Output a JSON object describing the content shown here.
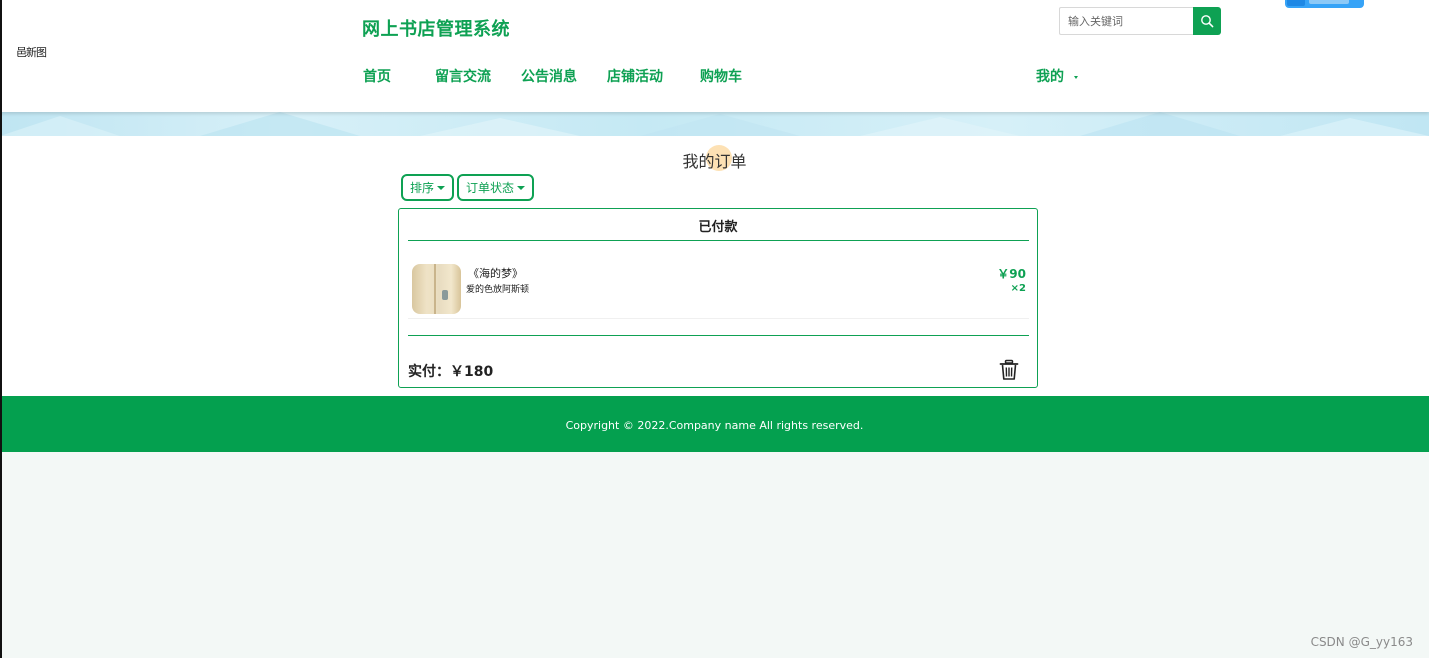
{
  "header": {
    "side_text": "邑新图",
    "site_title": "网上书店管理系统",
    "search": {
      "placeholder": "输入关键词",
      "value": ""
    },
    "nav": {
      "home": "首页",
      "messages": "留言交流",
      "notices": "公告消息",
      "activities": "店铺活动",
      "cart": "购物车",
      "mine": "我的"
    },
    "icons": {
      "search": "search-icon",
      "caret": "caret-down-icon"
    }
  },
  "main": {
    "page_title": "我的订单",
    "filters": {
      "sort_label": "排序",
      "status_label": "订单状态"
    },
    "orders": [
      {
        "status": "已付款",
        "items": [
          {
            "name": "《海的梦》",
            "author": "爱的色放阿斯顿",
            "price": "￥90",
            "quantity": "×2"
          }
        ],
        "total_label": "实付：￥180",
        "delete_icon": "trash-icon"
      }
    ]
  },
  "footer": {
    "copyright": "Copyright © 2022.Company name All rights reserved."
  },
  "watermark": "CSDN @G_yy163",
  "colors": {
    "brand": "#0ea153",
    "footer": "#04a04f",
    "banner": "#cdeef7",
    "page_bg": "#f3f8f6"
  }
}
